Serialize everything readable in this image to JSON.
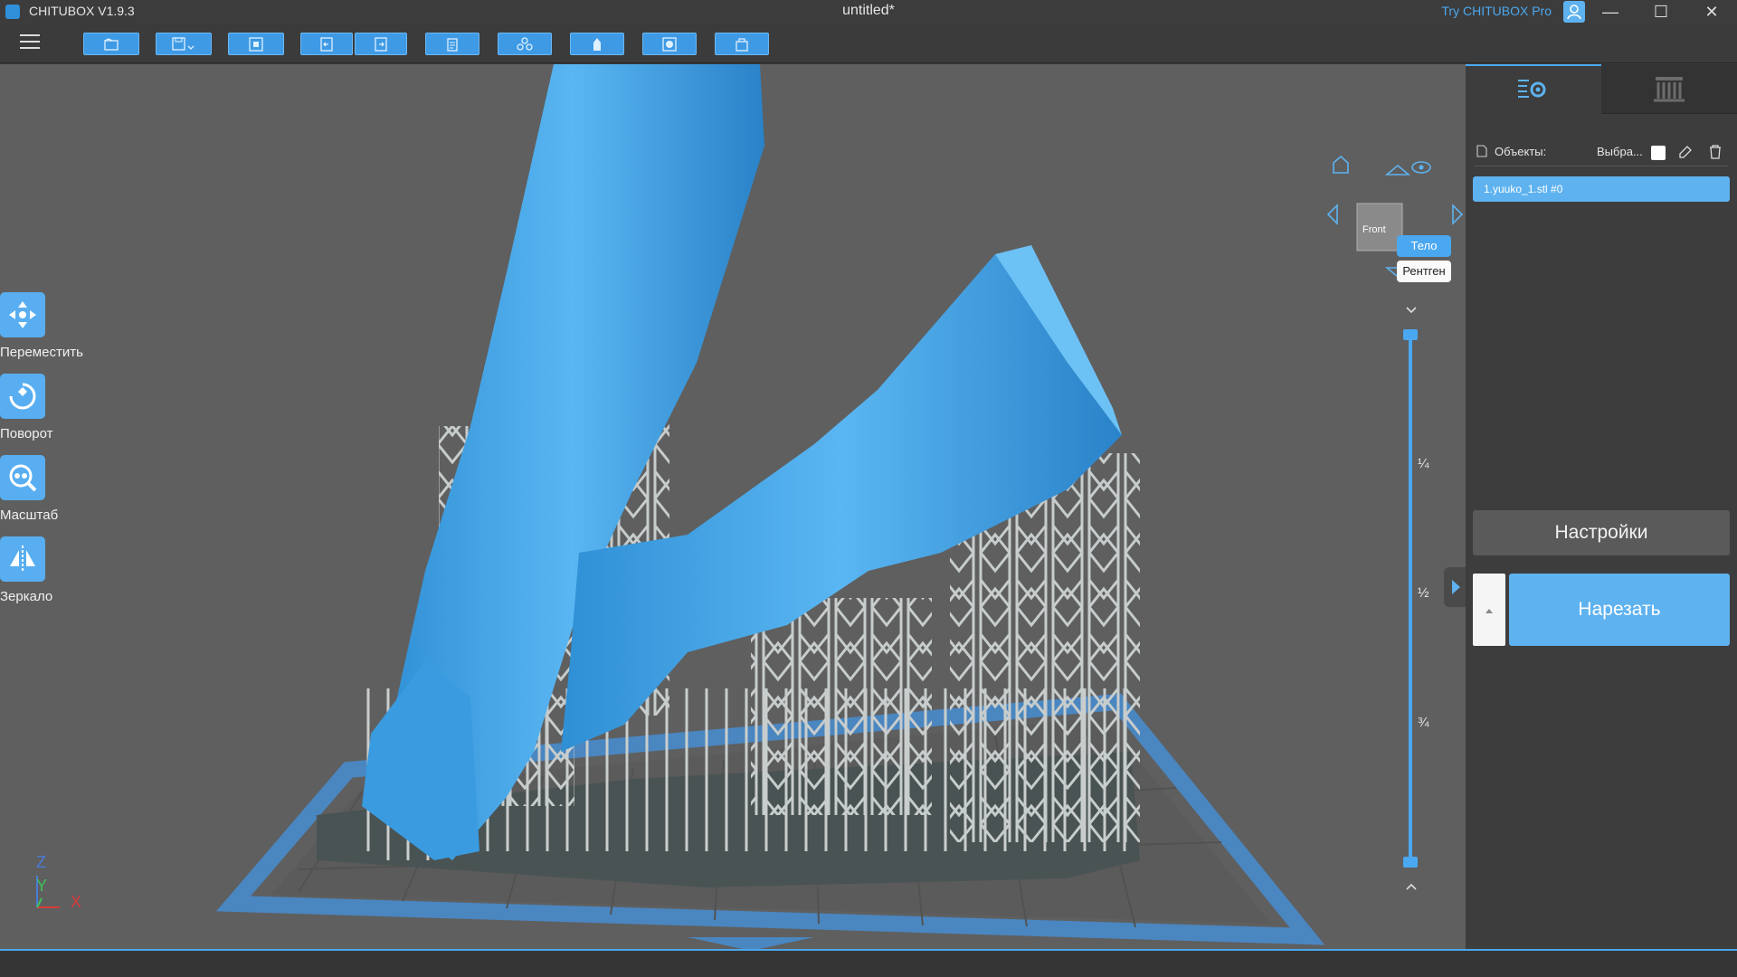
{
  "window": {
    "app_title": "CHITUBOX V1.9.3",
    "doc_title": "untitled*",
    "pro_link": "Try CHITUBOX Pro",
    "minimize": "—",
    "maximize": "☐",
    "close": "✕"
  },
  "toolbar": {
    "buttons": [
      "open-file-icon",
      "save-icon",
      "import-icon",
      "undo-icon",
      "redo-icon",
      "clipboard-icon",
      "arrange-icon",
      "support-icon",
      "hollow-icon",
      "print-icon"
    ]
  },
  "left_tools": [
    {
      "label": "Переместить",
      "icon": "move-icon"
    },
    {
      "label": "Поворот",
      "icon": "rotate-icon"
    },
    {
      "label": "Масштаб",
      "icon": "scale-icon"
    },
    {
      "label": "Зеркало",
      "icon": "mirror-icon"
    }
  ],
  "axis": {
    "z": "Z",
    "y": "Y",
    "x": "X"
  },
  "navcube": {
    "face": "Front"
  },
  "view_mode": {
    "body": "Тело",
    "xray": "Рентген",
    "active": "body"
  },
  "layer_slider": {
    "quarter": "¼",
    "half": "½",
    "three_quarter": "¾"
  },
  "right_panel": {
    "objects_label": "Объекты:",
    "select_label": "Выбра...",
    "objects": [
      "1.yuuko_1.stl #0"
    ],
    "settings_button": "Настройки",
    "slice_button": "Нарезать"
  },
  "colors": {
    "accent": "#5eb2ef",
    "model": "#3fa2e6",
    "support": "#c9cdcd",
    "platform": "#4a86c0"
  }
}
